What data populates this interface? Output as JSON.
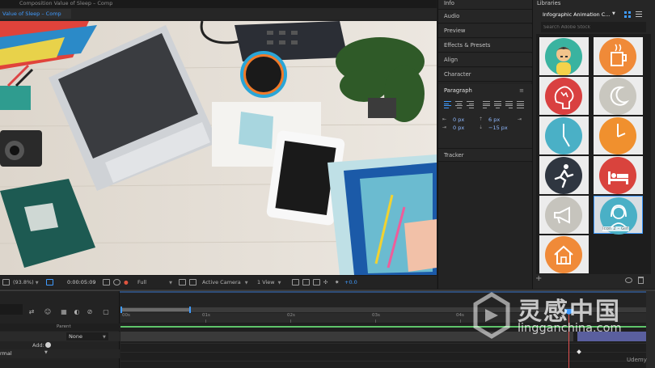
{
  "composition": {
    "window_title": "Composition Value of Sleep – Comp",
    "tab_label": "Value of Sleep – Comp",
    "footer": {
      "zoom": "(93.8%)",
      "timecode": "0:00:05:09",
      "resolution": "Full",
      "camera": "Active Camera",
      "views": "1 View",
      "exposure": "+0.0"
    }
  },
  "panels": {
    "items": [
      "Info",
      "Audio",
      "Preview",
      "Effects & Presets",
      "Align",
      "Character"
    ],
    "paragraph": {
      "title": "Paragraph",
      "indent_left": "0 px",
      "indent_first": "0 px",
      "space_before": "6 px",
      "space_after": "−15 px"
    },
    "tracker": "Tracker"
  },
  "libraries": {
    "title": "Libraries",
    "selected_library": "Infographic Animation C...",
    "search_placeholder": "Search Adobe Stock",
    "hovered_tile_label": "Icon 2 – Girl",
    "tiles": [
      {
        "icon": "boy-icon",
        "color": "#3ab3a0"
      },
      {
        "icon": "coffee-icon",
        "color": "#f08a38"
      },
      {
        "icon": "brain-stress-icon",
        "color": "#d94040"
      },
      {
        "icon": "moon-icon",
        "color": "#c9c7bf"
      },
      {
        "icon": "clock-icon",
        "color": "#4ab0c6"
      },
      {
        "icon": "clock-icon",
        "color": "#f0902e"
      },
      {
        "icon": "running-man-icon",
        "color": "#2f3640"
      },
      {
        "icon": "bed-icon",
        "color": "#d9433d"
      },
      {
        "icon": "megaphone-icon",
        "color": "#c6c4bd"
      },
      {
        "icon": "girl-icon",
        "color": "#4ab0c6"
      },
      {
        "icon": "house-icon",
        "color": "#f08a38"
      }
    ]
  },
  "timeline": {
    "parent_header": "Parent",
    "parent_value": "None",
    "add_label": "Add:",
    "mode": "rmal",
    "ruler_ticks": [
      "00s",
      "01s",
      "02s",
      "03s",
      "04s"
    ]
  },
  "watermark": {
    "chinese": "灵感中国",
    "url": "lingganchina.com",
    "brand": "Udemy"
  }
}
